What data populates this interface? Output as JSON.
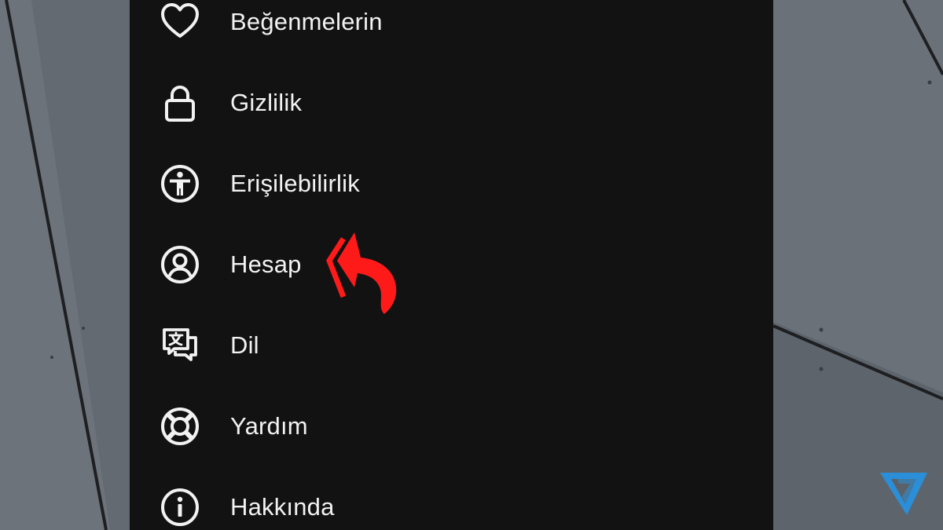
{
  "menu": {
    "items": [
      {
        "label": "Beğenmelerin",
        "icon": "heart-icon"
      },
      {
        "label": "Gizlilik",
        "icon": "lock-icon"
      },
      {
        "label": "Erişilebilirlik",
        "icon": "accessibility-icon"
      },
      {
        "label": "Hesap",
        "icon": "account-icon"
      },
      {
        "label": "Dil",
        "icon": "language-icon"
      },
      {
        "label": "Yardım",
        "icon": "lifebuoy-icon"
      },
      {
        "label": "Hakkında",
        "icon": "info-icon"
      }
    ]
  },
  "colors": {
    "menu_background": "#121212",
    "text": "#f2f2f2",
    "pointer_arrow": "#ff1a1a",
    "brand_logo": "#2a8fd8"
  }
}
